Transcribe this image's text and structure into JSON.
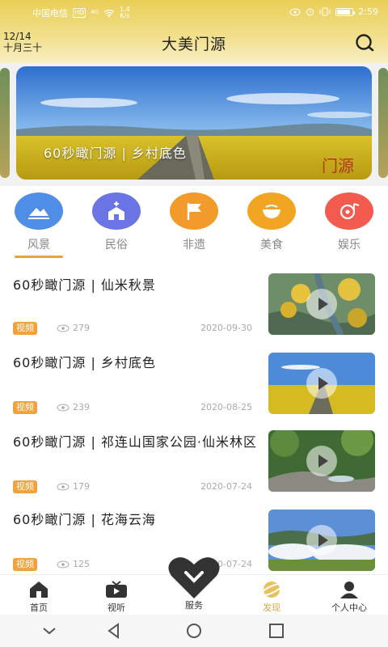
{
  "status_bar": {
    "carrier": "中国电信",
    "hd": "HD",
    "signal": "⁴ᴳ",
    "speed_value": "1.4",
    "speed_unit": "K/s",
    "time": "2:59"
  },
  "header": {
    "date_line1": "12/14",
    "date_line2": "十月三十",
    "title": "大美门源",
    "search_icon": "search-icon"
  },
  "banner": {
    "caption": "60秒瞰门源 | 乡村底色"
  },
  "categories": [
    {
      "label": "风景",
      "icon": "landscape-icon",
      "color": "#4e8ee6",
      "active": true
    },
    {
      "label": "民俗",
      "icon": "church-icon",
      "color": "#6a74e4",
      "active": false
    },
    {
      "label": "非遗",
      "icon": "flag-icon",
      "color": "#f29a2a",
      "active": false
    },
    {
      "label": "美食",
      "icon": "bowl-icon",
      "color": "#f2a423",
      "active": false
    },
    {
      "label": "娱乐",
      "icon": "music-icon",
      "color": "#f25b4d",
      "active": false
    }
  ],
  "feed": [
    {
      "title": "60秒瞰门源 | 仙米秋景",
      "tag": "视频",
      "views": "279",
      "date": "2020-09-30"
    },
    {
      "title": "60秒瞰门源 | 乡村底色",
      "tag": "视频",
      "views": "239",
      "date": "2020-08-25"
    },
    {
      "title": "60秒瞰门源 | 祁连山国家公园·仙米林区",
      "tag": "视频",
      "views": "179",
      "date": "2020-07-24"
    },
    {
      "title": "60秒瞰门源 | 花海云海",
      "tag": "视频",
      "views": "125",
      "date": "2020-07-24"
    }
  ],
  "tabbar": {
    "home": "首页",
    "media": "视听",
    "service": "服务",
    "discover": "发现",
    "profile": "个人中心",
    "accent": "#d4a94a"
  }
}
